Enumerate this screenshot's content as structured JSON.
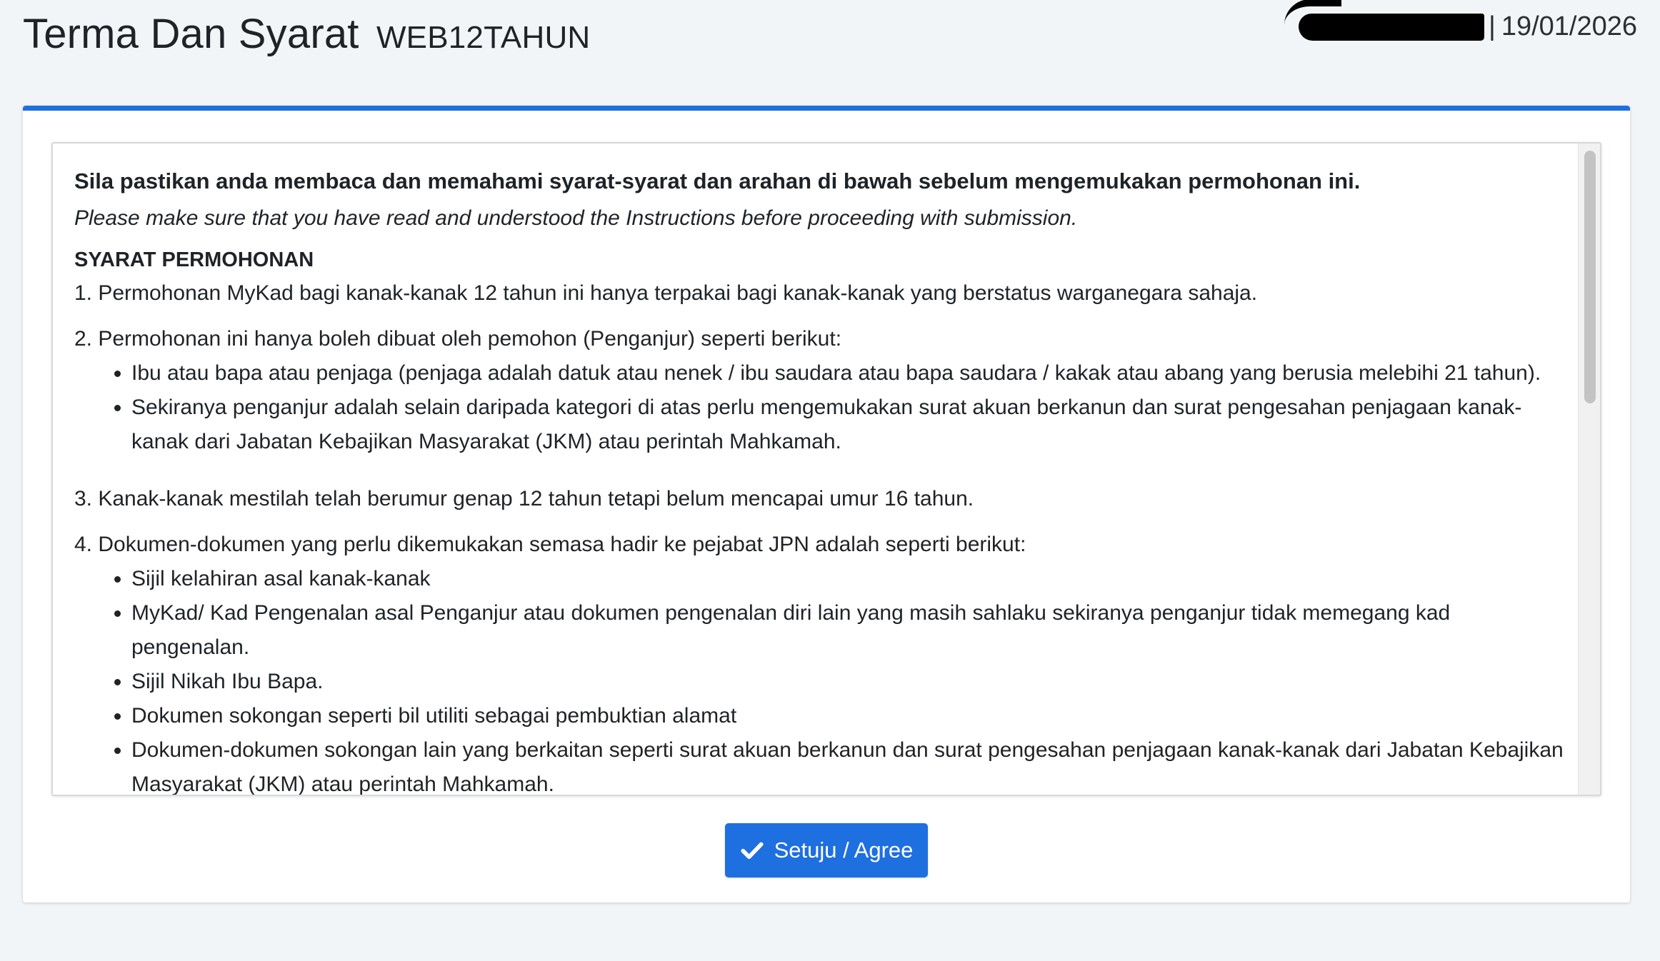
{
  "header": {
    "title": "Terma Dan Syarat",
    "code": "WEB12TAHUN",
    "separator": "|",
    "date": "19/01/2026"
  },
  "terms": {
    "intro_bold": "Sila pastikan anda membaca dan memahami syarat-syarat dan arahan di bawah sebelum mengemukakan permohonan ini.",
    "intro_italic": "Please make sure that you have read and understood the Instructions before proceeding with submission.",
    "heading": "SYARAT PERMOHONAN",
    "items": [
      {
        "text": "1. Permohonan MyKad bagi kanak-kanak 12 tahun ini hanya terpakai bagi kanak-kanak yang berstatus warganegara sahaja.",
        "bullets": []
      },
      {
        "text": "2. Permohonan ini hanya boleh dibuat oleh pemohon (Penganjur) seperti berikut:",
        "bullets": [
          "Ibu atau bapa atau penjaga (penjaga adalah datuk atau nenek / ibu saudara atau bapa saudara / kakak atau abang yang berusia melebihi 21 tahun).",
          "Sekiranya penganjur adalah selain daripada kategori di atas perlu mengemukakan surat akuan berkanun dan surat pengesahan penjagaan kanak-kanak dari Jabatan Kebajikan Masyarakat (JKM) atau perintah Mahkamah."
        ]
      },
      {
        "text": "3. Kanak-kanak mestilah telah berumur genap 12 tahun tetapi belum mencapai umur 16 tahun.",
        "bullets": []
      },
      {
        "text": "4. Dokumen-dokumen yang perlu dikemukakan semasa hadir ke pejabat JPN adalah seperti berikut:",
        "bullets": [
          "Sijil kelahiran asal kanak-kanak",
          "MyKad/ Kad Pengenalan asal Penganjur atau dokumen pengenalan diri lain yang masih sahlaku sekiranya penganjur tidak memegang kad pengenalan.",
          "Sijil Nikah Ibu Bapa.",
          "Dokumen sokongan seperti bil utiliti sebagai pembuktian alamat",
          "Dokumen-dokumen sokongan lain yang berkaitan seperti surat akuan berkanun dan surat pengesahan penjagaan kanak-kanak dari Jabatan Kebajikan Masyarakat (JKM) atau perintah Mahkamah."
        ]
      }
    ]
  },
  "actions": {
    "agree_label": "Setuju / Agree",
    "agree_icon": "check-icon"
  },
  "colors": {
    "accent": "#1e6fe0",
    "background": "#f2f5f8",
    "text": "#1f2327"
  }
}
